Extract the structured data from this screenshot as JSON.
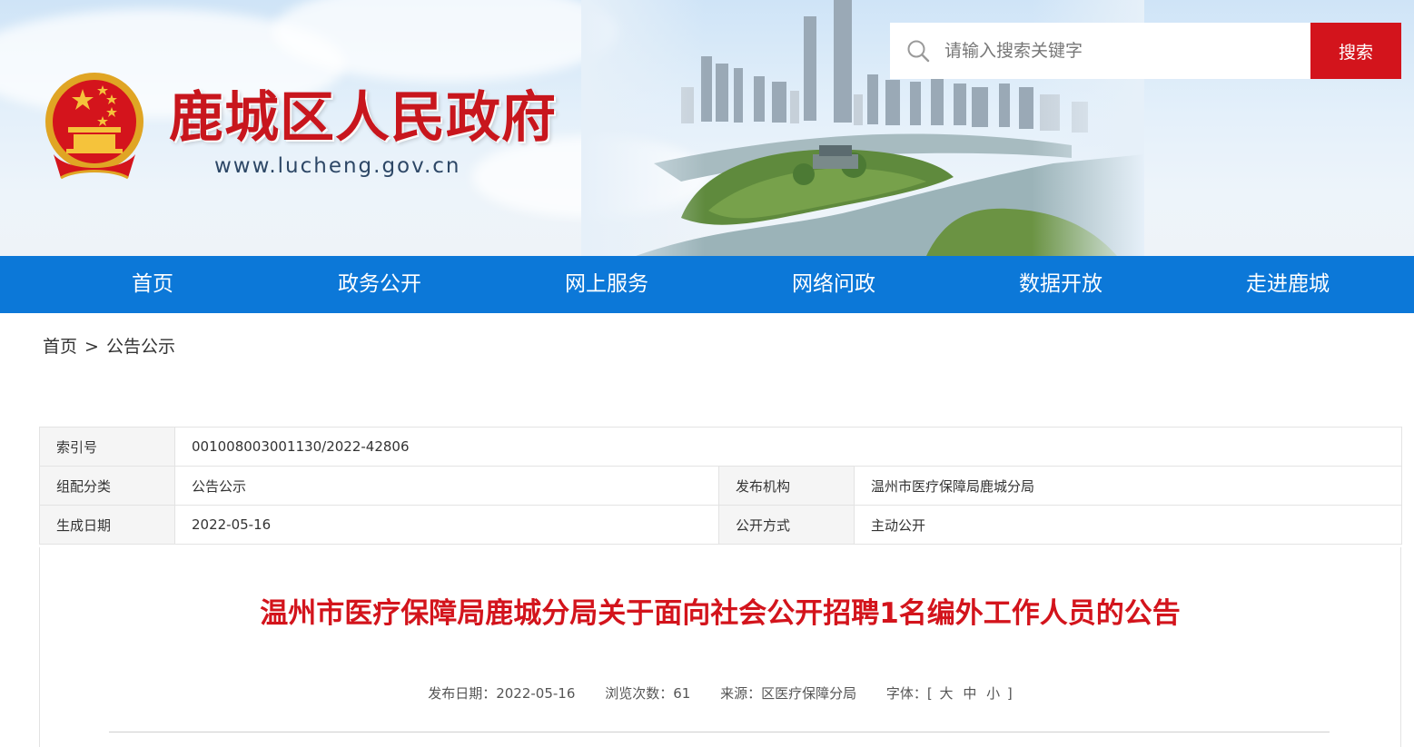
{
  "header": {
    "site_title": "鹿城区人民政府",
    "site_url": "www.lucheng.gov.cn",
    "search": {
      "placeholder": "请输入搜索关键字",
      "button_label": "搜索"
    }
  },
  "nav": {
    "items": [
      {
        "label": "首页"
      },
      {
        "label": "政务公开"
      },
      {
        "label": "网上服务"
      },
      {
        "label": "网络问政"
      },
      {
        "label": "数据开放"
      },
      {
        "label": "走进鹿城"
      }
    ]
  },
  "breadcrumb": {
    "home": "首页",
    "separator": ">",
    "current": "公告公示"
  },
  "info": {
    "index_label": "索引号",
    "index_value": "001008003001130/2022-42806",
    "category_label": "组配分类",
    "category_value": "公告公示",
    "publisher_label": "发布机构",
    "publisher_value": "温州市医疗保障局鹿城分局",
    "date_label": "生成日期",
    "date_value": "2022-05-16",
    "disclosure_label": "公开方式",
    "disclosure_value": "主动公开"
  },
  "article": {
    "title": "温州市医疗保障局鹿城分局关于面向社会公开招聘1名编外工作人员的公告",
    "publish_date": "发布日期：2022-05-16",
    "views": "浏览次数：61",
    "source": "来源：区医疗保障分局",
    "font_label": "字体：",
    "font_open": "[",
    "font_large": "大",
    "font_medium": "中",
    "font_small": "小",
    "font_close": "]"
  },
  "colors": {
    "brand_red": "#d3141c",
    "nav_blue": "#0c78d8"
  },
  "icons": {
    "search": "search-icon",
    "emblem": "national-emblem-icon"
  }
}
